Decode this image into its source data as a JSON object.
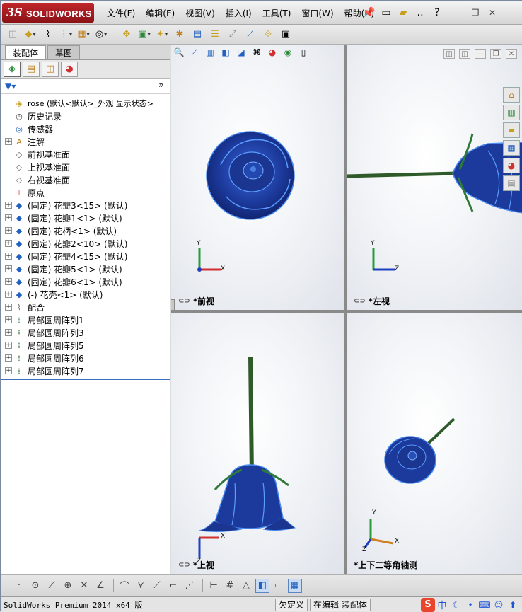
{
  "app": {
    "logo_ds": "3S",
    "logo_name": "SOLIDWORKS"
  },
  "menu": [
    "文件(F)",
    "编辑(E)",
    "视图(V)",
    "插入(I)",
    "工具(T)",
    "窗口(W)",
    "帮助(H)"
  ],
  "panel": {
    "tabs": [
      "装配体",
      "草图"
    ],
    "expand_label": "»",
    "filter_icon": "funnel-icon"
  },
  "tree": [
    {
      "label": "rose  (默认<默认>_外观 显示状态>",
      "icon": "assembly-icon",
      "indent": 0,
      "toggle": ""
    },
    {
      "label": "历史记录",
      "icon": "history-icon",
      "indent": 1,
      "toggle": ""
    },
    {
      "label": "传感器",
      "icon": "sensor-icon",
      "indent": 1,
      "toggle": ""
    },
    {
      "label": "注解",
      "icon": "annotation-icon",
      "indent": 1,
      "toggle": "+"
    },
    {
      "label": "前视基准面",
      "icon": "plane-icon",
      "indent": 1,
      "toggle": ""
    },
    {
      "label": "上视基准面",
      "icon": "plane-icon",
      "indent": 1,
      "toggle": ""
    },
    {
      "label": "右视基准面",
      "icon": "plane-icon",
      "indent": 1,
      "toggle": ""
    },
    {
      "label": "原点",
      "icon": "origin-icon",
      "indent": 1,
      "toggle": ""
    },
    {
      "label": "(固定) 花瓣3<15> (默认)",
      "icon": "part-icon",
      "indent": 1,
      "toggle": "+"
    },
    {
      "label": "(固定) 花瓣1<1> (默认)",
      "icon": "part-icon",
      "indent": 1,
      "toggle": "+"
    },
    {
      "label": "(固定) 花柄<1> (默认)",
      "icon": "part-icon",
      "indent": 1,
      "toggle": "+"
    },
    {
      "label": "(固定) 花瓣2<10> (默认)",
      "icon": "part-icon",
      "indent": 1,
      "toggle": "+"
    },
    {
      "label": "(固定) 花瓣4<15> (默认)",
      "icon": "part-icon",
      "indent": 1,
      "toggle": "+"
    },
    {
      "label": "(固定) 花瓣5<1> (默认)",
      "icon": "part-icon",
      "indent": 1,
      "toggle": "+"
    },
    {
      "label": "(固定) 花瓣6<1> (默认)",
      "icon": "part-icon",
      "indent": 1,
      "toggle": "+"
    },
    {
      "label": "(-) 花壳<1> (默认)",
      "icon": "part-icon",
      "indent": 1,
      "toggle": "+"
    },
    {
      "label": "配合",
      "icon": "mates-icon",
      "indent": 1,
      "toggle": "+"
    },
    {
      "label": "局部圆周阵列1",
      "icon": "pattern-icon",
      "indent": 1,
      "toggle": "+"
    },
    {
      "label": "局部圆周阵列3",
      "icon": "pattern-icon",
      "indent": 1,
      "toggle": "+"
    },
    {
      "label": "局部圆周阵列5",
      "icon": "pattern-icon",
      "indent": 1,
      "toggle": "+"
    },
    {
      "label": "局部圆周阵列6",
      "icon": "pattern-icon",
      "indent": 1,
      "toggle": "+"
    },
    {
      "label": "局部圆周阵列7",
      "icon": "pattern-icon",
      "indent": 1,
      "toggle": "+"
    }
  ],
  "viewports": {
    "front": {
      "label": "*前视",
      "axis1": "Y",
      "axis2": "X"
    },
    "left": {
      "label": "*左视",
      "axis1": "Y",
      "axis2": "Z"
    },
    "top": {
      "label": "*上视",
      "axis1": "X",
      "axis2": "Z"
    },
    "iso": {
      "label": "*上下二等角轴测",
      "axis1": "Y",
      "axis2": "X",
      "axis3": "Z"
    }
  },
  "status": {
    "product": "SolidWorks Premium 2014 x64 版",
    "state": "欠定义",
    "mode": "在编辑 装配体",
    "ime": "中"
  },
  "colors": {
    "rose_blue": "#1c3a9c",
    "stem_green": "#2f5a2a",
    "brand_red": "#b51e24"
  }
}
